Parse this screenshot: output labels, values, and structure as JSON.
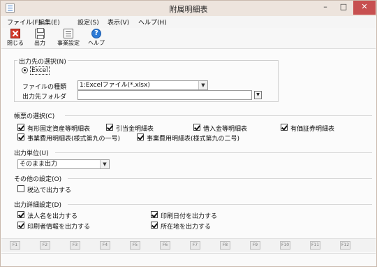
{
  "window": {
    "title": "附属明細表"
  },
  "titlebar_buttons": {
    "minimize": "–",
    "maximize": "□",
    "close": "✕"
  },
  "menu": [
    {
      "label": "ファイル(F)"
    },
    {
      "label": "編集(E)"
    },
    {
      "label": "設定(S)"
    },
    {
      "label": "表示(V)"
    },
    {
      "label": "ヘルプ(H)"
    }
  ],
  "toolbar": [
    {
      "label": "閉じる",
      "icon": "close-icon"
    },
    {
      "label": "出力",
      "icon": "printer-icon"
    },
    {
      "label": "事業設定",
      "icon": "settings-list-icon"
    },
    {
      "label": "ヘルプ",
      "icon": "help-icon",
      "glyph": "?"
    }
  ],
  "output_destination": {
    "title": "出力先の選択(N)",
    "radio_label": "Excel",
    "radio_selected": true,
    "file_type_label": "ファイルの種類",
    "file_type_value": "1:Excelファイル(*.xlsx)",
    "folder_label": "出力先フォルダ",
    "folder_value": "",
    "select_arrow": "▼",
    "folder_button": "▼"
  },
  "report_selection": {
    "title": "帳票の選択(C)",
    "items": [
      {
        "label": "有形固定資産等明細表",
        "checked": true
      },
      {
        "label": "引当金明細表",
        "checked": true
      },
      {
        "label": "借入金等明細表",
        "checked": true
      },
      {
        "label": "有価証券明細表",
        "checked": true
      },
      {
        "label": "事業費用明細表(様式第九の一号)",
        "checked": true
      },
      {
        "label": "事業費用明細表(様式第九の二号)",
        "checked": true
      }
    ]
  },
  "output_unit": {
    "title": "出力単位(U)",
    "value": "そのまま出力",
    "arrow": "▼"
  },
  "other_settings": {
    "title": "その他の設定(O)",
    "items": [
      {
        "label": "税込で出力する",
        "checked": false
      }
    ]
  },
  "detail_settings": {
    "title": "出力詳細設定(D)",
    "items": [
      {
        "label": "法人名を出力する",
        "checked": true
      },
      {
        "label": "印刷日付を出力する",
        "checked": true
      },
      {
        "label": "印刷者情報を出力する",
        "checked": true
      },
      {
        "label": "所在地を出力する",
        "checked": true
      }
    ]
  },
  "function_keys": [
    "F1",
    "F2",
    "F3",
    "F4",
    "F5",
    "F6",
    "F7",
    "F8",
    "F9",
    "F10",
    "F11",
    "F12"
  ]
}
